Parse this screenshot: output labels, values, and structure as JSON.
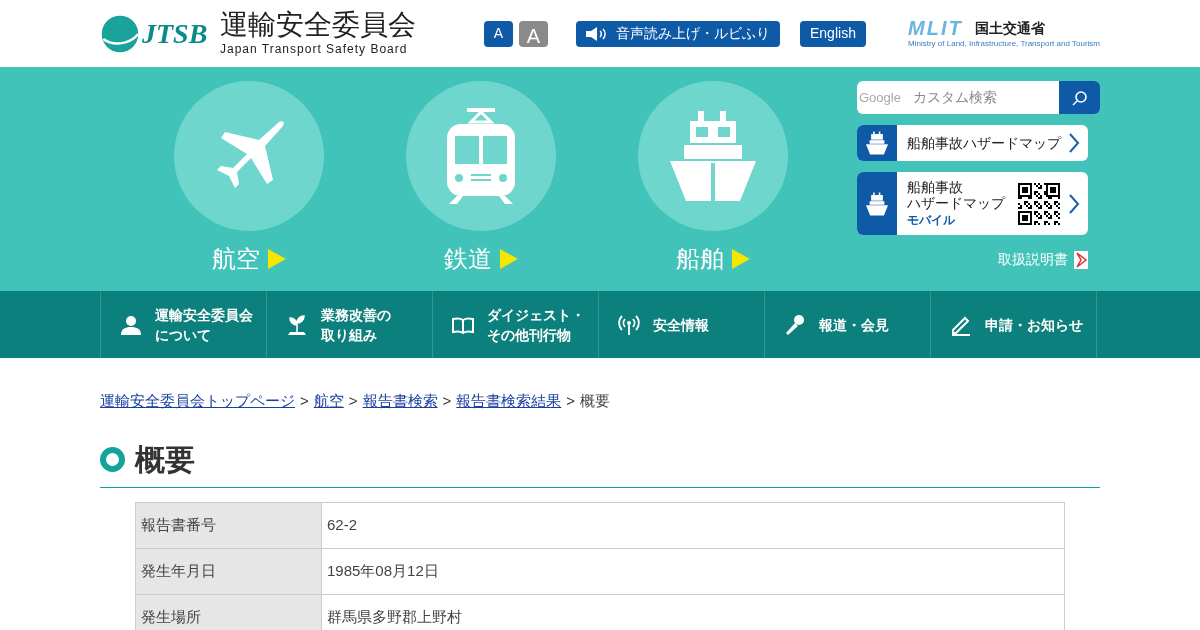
{
  "header": {
    "logo_mark": "JTSB",
    "title": "運輸安全委員会",
    "subtitle": "Japan Transport Safety Board",
    "font_sizes": [
      {
        "label": "A",
        "selected": true
      },
      {
        "label": "A",
        "selected": false
      }
    ],
    "speech_button": "音声読み上げ・ルビふり",
    "english_button": "English",
    "ministry": {
      "mark": "MLIT",
      "name": "国土交通省",
      "subtitle": "Ministry of Land, Infrastructure, Transport and Tourism"
    }
  },
  "modes": [
    {
      "kind": "plane",
      "label": "航空"
    },
    {
      "kind": "train",
      "label": "鉄道"
    },
    {
      "kind": "ship",
      "label": "船舶"
    }
  ],
  "search": {
    "brand": "Google",
    "placeholder": "カスタム検索"
  },
  "hazard_links": [
    {
      "lines": [
        "船舶事故ハザードマップ"
      ],
      "qr": false
    },
    {
      "lines": [
        "船舶事故",
        "ハザードマップ"
      ],
      "sub": "モバイル",
      "qr": true
    }
  ],
  "manual_link": "取扱説明書",
  "nav": [
    {
      "lines": [
        "運輸安全委員会",
        "について"
      ]
    },
    {
      "lines": [
        "業務改善の",
        "取り組み"
      ]
    },
    {
      "lines": [
        "ダイジェスト・",
        "その他刊行物"
      ]
    },
    {
      "lines": [
        "安全情報"
      ]
    },
    {
      "lines": [
        "報道・会見"
      ]
    },
    {
      "lines": [
        "申請・お知らせ"
      ]
    }
  ],
  "breadcrumb": {
    "links": [
      "運輸安全委員会トップページ",
      "航空",
      "報告書検索",
      "報告書検索結果"
    ],
    "separator": ">",
    "current": "概要"
  },
  "heading": "概要",
  "table": [
    {
      "label": "報告書番号",
      "value": "62-2"
    },
    {
      "label": "発生年月日",
      "value": "1985年08月12日"
    },
    {
      "label": "発生場所",
      "value": "群馬県多野郡上野村"
    }
  ]
}
